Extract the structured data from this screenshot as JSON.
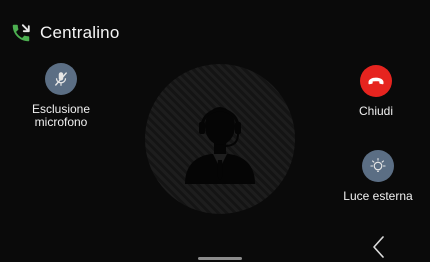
{
  "header": {
    "title": "Centralino",
    "icon": "phone-call-icon"
  },
  "caller": {
    "avatar_icon": "operator-headset-icon"
  },
  "actions": {
    "mute": {
      "label_line1": "Esclusione",
      "label_line2": "microfono",
      "icon": "microphone-off-icon",
      "color": "#5b6e84"
    },
    "hangup": {
      "label": "Chiudi",
      "icon": "phone-hangup-icon",
      "color": "#e6241f"
    },
    "light": {
      "label": "Luce esterna",
      "icon": "lightbulb-icon",
      "color": "#5b6e84"
    }
  },
  "navigation": {
    "back_icon": "chevron-left-icon"
  },
  "colors": {
    "background": "#0a0a0a",
    "accent_green": "#4caf50",
    "accent_red": "#e6241f",
    "button_slate": "#5b6e84"
  }
}
